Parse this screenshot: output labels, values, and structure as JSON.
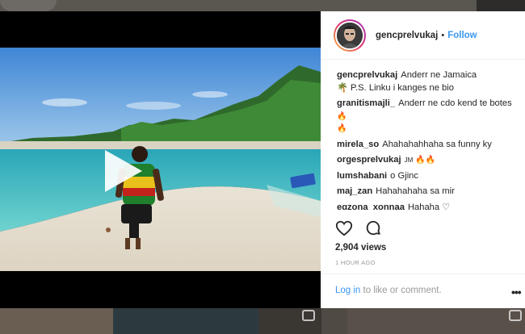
{
  "post": {
    "username": "gencprelvukaj",
    "separator": "•",
    "follow_label": "Follow",
    "caption_user": "gencprelvukaj",
    "caption_text": "Anderr ne Jamaica",
    "caption_text2": "🌴 P.S. Linku i kanges ne bio",
    "views": "2,904 views",
    "timestamp": "1 HOUR AGO"
  },
  "comments": [
    {
      "user": "granitismajli_",
      "text": "Anderr ne cdo kend te botes",
      "emoji": "🔥",
      "emoji2": "🔥"
    },
    {
      "user": "mirela_so",
      "text": "Ahahahahhaha sa funny ky",
      "emoji": "",
      "emoji2": ""
    },
    {
      "user": "orgesprelvukaj",
      "text": "JM",
      "emoji": "🔥🔥",
      "emoji2": ""
    },
    {
      "user": "lumshabani",
      "text": "o Gjinc",
      "emoji": "",
      "emoji2": ""
    },
    {
      "user": "maj_zan",
      "text": "Hahahahaha sa mir",
      "emoji": "",
      "emoji2": ""
    },
    {
      "user": "egzona_xonnaa",
      "text": "Hahaha ♡",
      "emoji": "",
      "emoji2": ""
    }
  ],
  "footer": {
    "login_label": "Log in",
    "login_suffix": " to like or comment."
  },
  "icons": {
    "like": "heart-icon",
    "comment": "comment-icon",
    "more": "more-options-icon",
    "play": "play-icon"
  },
  "colors": {
    "link": "#3897f0",
    "text": "#262626",
    "muted": "#999999"
  }
}
